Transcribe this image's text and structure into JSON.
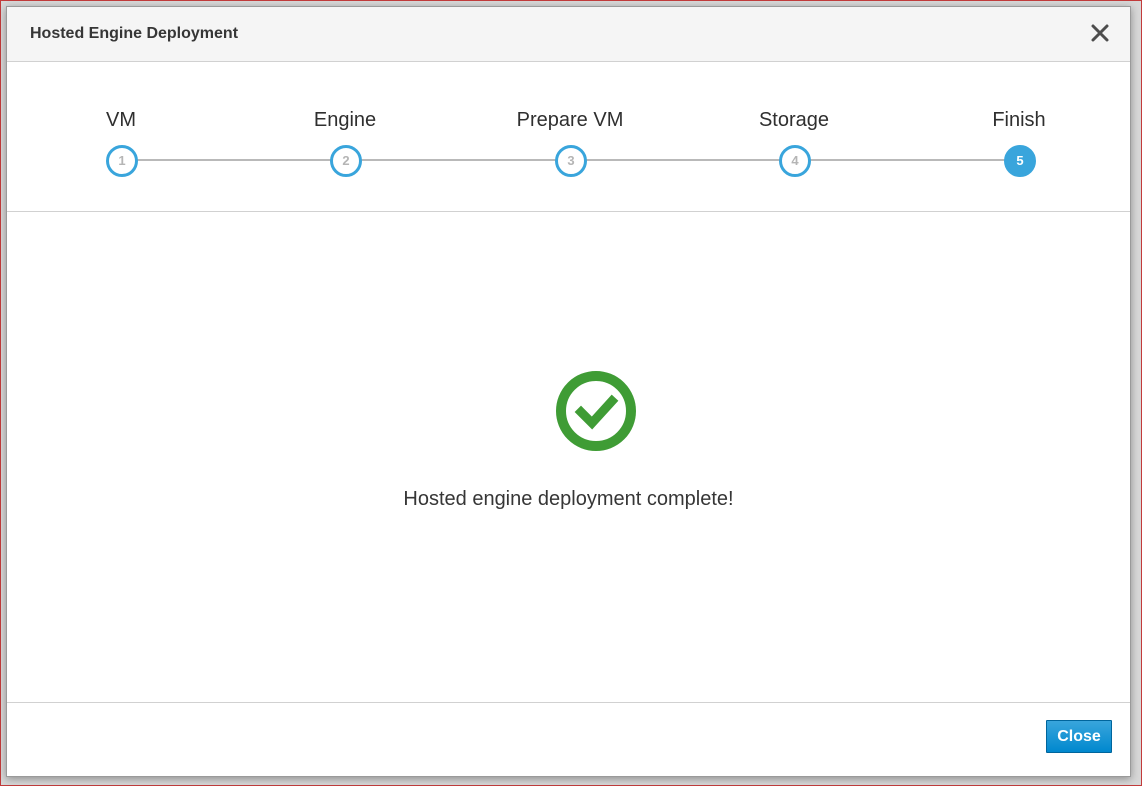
{
  "dialog": {
    "title": "Hosted Engine Deployment",
    "close_icon": "close-icon"
  },
  "wizard": {
    "current_step": 5,
    "accent_color": "#39a5dc",
    "steps": [
      {
        "label": "VM",
        "number": "1"
      },
      {
        "label": "Engine",
        "number": "2"
      },
      {
        "label": "Prepare VM",
        "number": "3"
      },
      {
        "label": "Storage",
        "number": "4"
      },
      {
        "label": "Finish",
        "number": "5"
      }
    ]
  },
  "result": {
    "icon": "success-check-icon",
    "icon_color": "#3f9c35",
    "message": "Hosted engine deployment complete!"
  },
  "footer": {
    "close_label": "Close"
  }
}
